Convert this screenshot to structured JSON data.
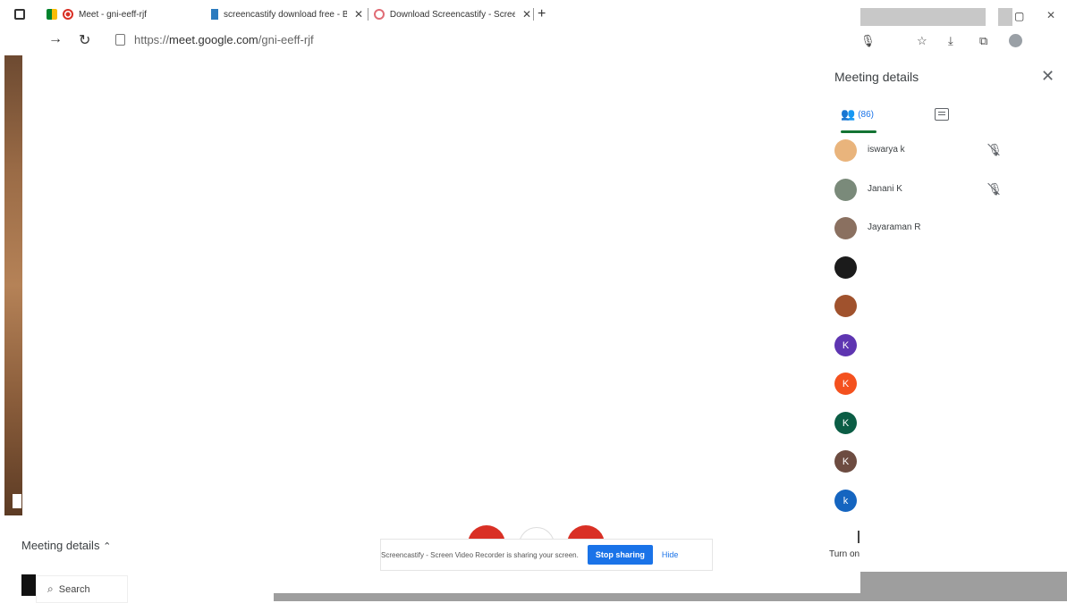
{
  "browser": {
    "tabs": [
      {
        "title": "Meet - gni-eeff-rjf",
        "icon": "recording-icon"
      },
      {
        "title": "screencastify download free - Bi",
        "icon": "bing-icon"
      },
      {
        "title": "Download Screencastify - Screen",
        "icon": "screencastify-icon"
      }
    ],
    "new_tab_glyph": "+",
    "close_glyph": "✕",
    "url_prefix": "https://",
    "url_domain": "meet.google.com",
    "url_path": "/gni-eeff-rjf",
    "window_controls": {
      "restore": "▢",
      "close": "✕"
    }
  },
  "panel": {
    "title": "Meeting details",
    "people_count": "(86)",
    "participants": [
      {
        "name": "iswarya k",
        "color": "#e9b47c",
        "initial": "",
        "mic_muted": true
      },
      {
        "name": "Janani K",
        "color": "#7a8a7a",
        "initial": "",
        "mic_muted": true
      },
      {
        "name": "Jayaraman R",
        "color": "#8a7060",
        "initial": "",
        "mic_muted": false
      },
      {
        "name": "",
        "color": "#1b1b1b",
        "initial": "",
        "mic_muted": false
      },
      {
        "name": "",
        "color": "#a0522d",
        "initial": "",
        "mic_muted": false
      },
      {
        "name": "",
        "color": "#5e35b1",
        "initial": "K",
        "mic_muted": false
      },
      {
        "name": "",
        "color": "#f4511e",
        "initial": "K",
        "mic_muted": false
      },
      {
        "name": "",
        "color": "#0b5d45",
        "initial": "K",
        "mic_muted": false
      },
      {
        "name": "",
        "color": "#6d4c41",
        "initial": "K",
        "mic_muted": false
      },
      {
        "name": "",
        "color": "#1565c0",
        "initial": "k",
        "mic_muted": false
      }
    ],
    "turn_on_label": "Turn on"
  },
  "bottom": {
    "meeting_details_label": "Meeting details",
    "share_text": "Screencastify - Screen Video Recorder is sharing your screen.",
    "stop_sharing_label": "Stop sharing",
    "hide_label": "Hide"
  },
  "taskbar": {
    "search_label": "Search"
  }
}
